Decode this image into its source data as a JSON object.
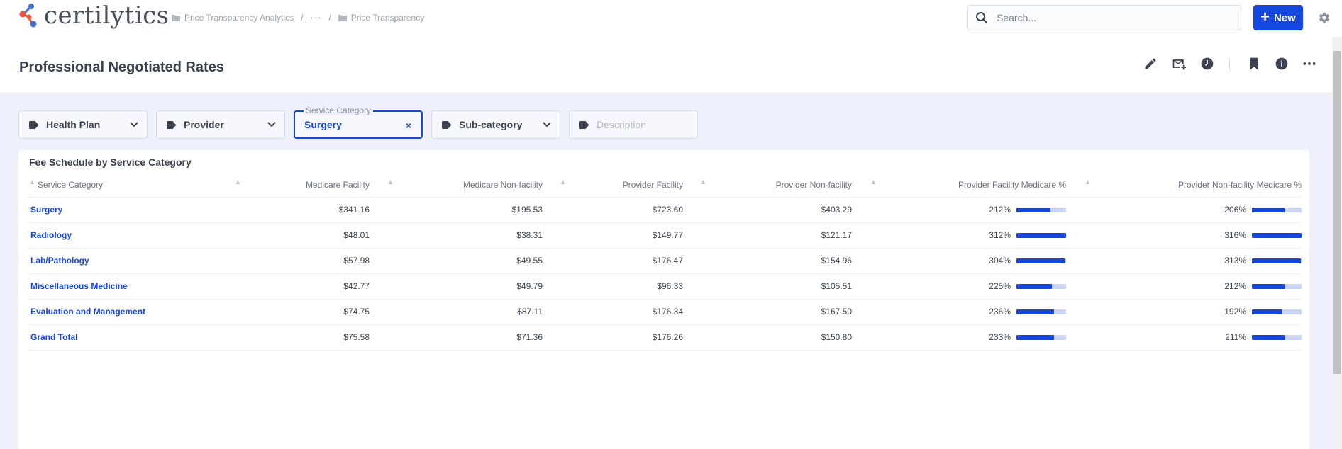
{
  "app": {
    "logo_text": "certilytics"
  },
  "breadcrumb": {
    "items": [
      "Price Transparency Analytics",
      "···",
      "Price Transparency"
    ],
    "separator": "/"
  },
  "search": {
    "placeholder": "Search..."
  },
  "header": {
    "new_label": "New"
  },
  "page": {
    "title": "Professional Negotiated Rates"
  },
  "icons": {
    "edit": "pencil-icon",
    "subscribe": "email-add-icon",
    "history": "clock-icon",
    "bookmark": "bookmark-icon",
    "info": "info-icon",
    "more": "more-horizontal-icon",
    "settings": "gear-icon",
    "tag": "tag-icon"
  },
  "filters": {
    "health_plan": "Health Plan",
    "provider": "Provider",
    "service_category_label": "Service Category",
    "service_category_value": "Surgery",
    "clear": "×",
    "sub_category": "Sub-category",
    "description": "Description"
  },
  "table": {
    "title": "Fee Schedule by Service Category",
    "columns": [
      "Service Category",
      "Medicare Facility",
      "Medicare Non-facility",
      "Provider Facility",
      "Provider Non-facility",
      "Provider Facility Medicare %",
      "Provider Non-facility Medicare %"
    ],
    "rows": [
      {
        "category": "Surgery",
        "medicare_facility": "$341.16",
        "medicare_nonfacility": "$195.53",
        "provider_facility": "$723.60",
        "provider_nonfacility": "$403.29",
        "pf_pct": "212%",
        "pf_level": 0.68,
        "pnf_pct": "206%",
        "pnf_level": 0.66
      },
      {
        "category": "Radiology",
        "medicare_facility": "$48.01",
        "medicare_nonfacility": "$38.31",
        "provider_facility": "$149.77",
        "provider_nonfacility": "$121.17",
        "pf_pct": "312%",
        "pf_level": 1.0,
        "pnf_pct": "316%",
        "pnf_level": 1.0
      },
      {
        "category": "Lab/Pathology",
        "medicare_facility": "$57.98",
        "medicare_nonfacility": "$49.55",
        "provider_facility": "$176.47",
        "provider_nonfacility": "$154.96",
        "pf_pct": "304%",
        "pf_level": 0.97,
        "pnf_pct": "313%",
        "pnf_level": 0.99
      },
      {
        "category": "Miscellaneous Medicine",
        "medicare_facility": "$42.77",
        "medicare_nonfacility": "$49.79",
        "provider_facility": "$96.33",
        "provider_nonfacility": "$105.51",
        "pf_pct": "225%",
        "pf_level": 0.72,
        "pnf_pct": "212%",
        "pnf_level": 0.67
      },
      {
        "category": "Evaluation and Management",
        "medicare_facility": "$74.75",
        "medicare_nonfacility": "$87.11",
        "provider_facility": "$176.34",
        "provider_nonfacility": "$167.50",
        "pf_pct": "236%",
        "pf_level": 0.76,
        "pnf_pct": "192%",
        "pnf_level": 0.61
      },
      {
        "category": "Grand Total",
        "medicare_facility": "$75.58",
        "medicare_nonfacility": "$71.36",
        "provider_facility": "$176.26",
        "provider_nonfacility": "$150.80",
        "pf_pct": "233%",
        "pf_level": 0.75,
        "pnf_pct": "211%",
        "pnf_level": 0.67
      }
    ]
  },
  "colors": {
    "accent": "#1446e0",
    "bar_track": "#c9d4f7",
    "filter_bg": "#eef1fc",
    "logo_red": "#e8533a",
    "logo_blue": "#3a6fd8"
  }
}
